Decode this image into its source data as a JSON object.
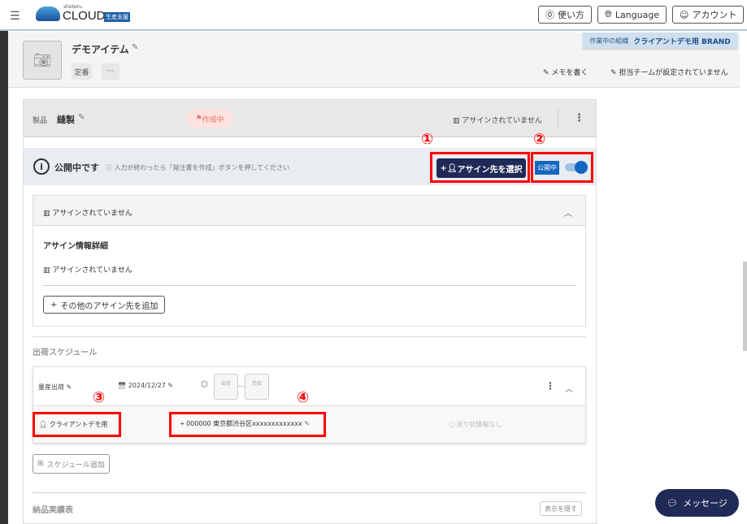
{
  "header": {
    "logo_small": "shoteru",
    "logo_text": "CLOUD",
    "logo_badge": "生産支援",
    "help": "使い方",
    "language": "Language",
    "account": "アカウント"
  },
  "org": {
    "label": "作業中の組織",
    "name": "クライアントデモ用 BRAND"
  },
  "item": {
    "title": "デモアイテム",
    "tag": "定番",
    "more": "···",
    "memo": "メモを書く",
    "team": "担当チームが設定されていません"
  },
  "product": {
    "label": "製品",
    "name": "縫製",
    "status": "作成中",
    "assign_status": "アサインされていません"
  },
  "publish": {
    "title": "公開中です",
    "hint": "入力が終わったら「発注書を作成」ボタンを押してください",
    "assign_button": "アサイン先を選択",
    "toggle_label": "公開中",
    "toggle_on": true
  },
  "annotations": [
    "①",
    "②",
    "③",
    "④"
  ],
  "assign": {
    "header": "アサインされていません",
    "detail_title": "アサイン情報詳細",
    "detail_value": "アサインされていません",
    "add_button": "その他のアサイン先を追加"
  },
  "schedule": {
    "title": "出荷スケジュール",
    "type": "量産出荷",
    "date": "2024/12/27",
    "step1": "出荷",
    "step2": "受取",
    "client": "クライアントデモ用",
    "address": "000000 東京都渋谷区xxxxxxxxxxxxx",
    "tracking": "送り状情報なし",
    "add_button": "スケジュール追加"
  },
  "delivery": {
    "title": "納品実績表",
    "hide_button": "表示を隠す"
  },
  "message_button": "メッセージ",
  "colors": {
    "accent": "#1f2a56",
    "toggle": "#1565c0",
    "annotation": "#ff0000",
    "status_bg": "#fde2e0",
    "status_text": "#e57368"
  }
}
